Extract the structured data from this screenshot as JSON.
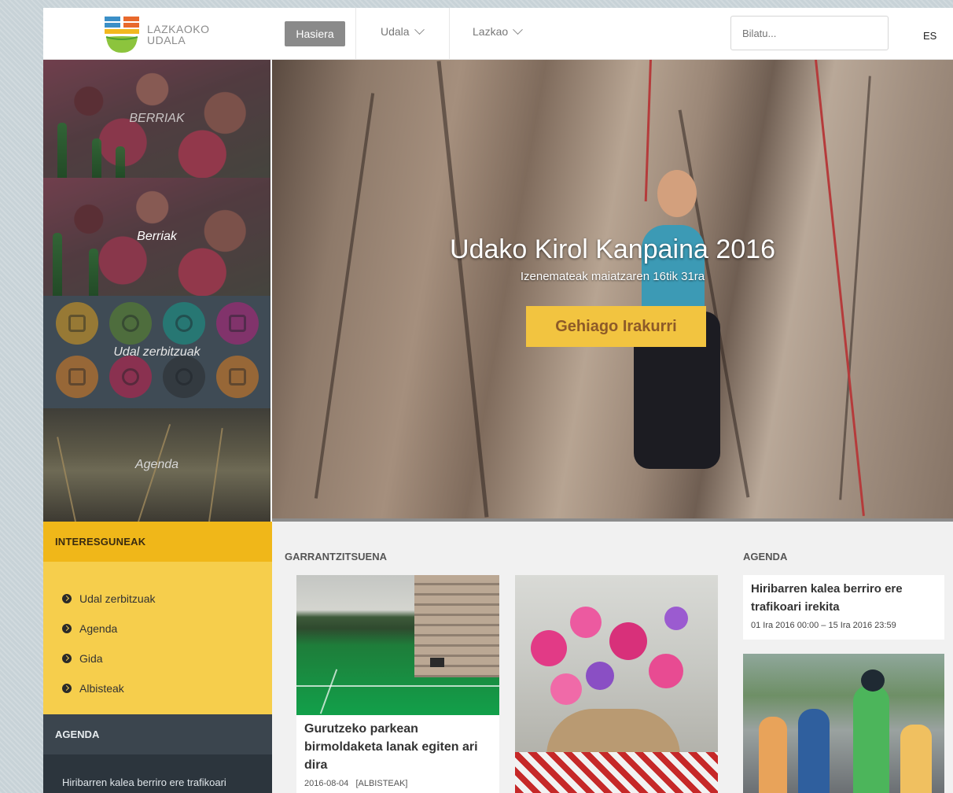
{
  "header": {
    "logo_line1": "LAZKAOKO",
    "logo_line2": "UDALA",
    "nav": {
      "home": "Hasiera",
      "udala": "Udala",
      "lazkao": "Lazkao"
    },
    "search_placeholder": "Bilatu...",
    "lang": "ES"
  },
  "tiles": {
    "berriak_upper": "BERRIAK",
    "berriak": "Berriak",
    "udal_zerbitzuak": "Udal zerbitzuak",
    "agenda": "Agenda"
  },
  "hero": {
    "title": "Udako Kirol Kanpaina 2016",
    "subtitle": "Izenemateak maiatzaren 16tik 31ra",
    "button": "Gehiago Irakurri"
  },
  "sidebar": {
    "interesguneak_title": "INTERESGUNEAK",
    "links": [
      "Udal zerbitzuak",
      "Agenda",
      "Gida",
      "Albisteak"
    ],
    "agenda_title": "AGENDA",
    "agenda_item": "Hiribarren kalea berriro ere trafikoari"
  },
  "main": {
    "garrantzitsuena_title": "GARRANTZITSUENA",
    "news": {
      "title": "Gurutzeko parkean birmoldaketa lanak egiten ari dira",
      "date": "2016-08-04",
      "category": "[ALBISTEAK]"
    },
    "agenda_title": "AGENDA",
    "agenda_event": {
      "title": "Hiribarren kalea berriro ere trafikoari irekita",
      "date": "01 Ira 2016 00:00 – 15 Ira 2016 23:59"
    }
  },
  "colors": {
    "accent_yellow": "#f2c440",
    "header_yellow": "#f0b719",
    "dark_slate": "#3b454e"
  }
}
